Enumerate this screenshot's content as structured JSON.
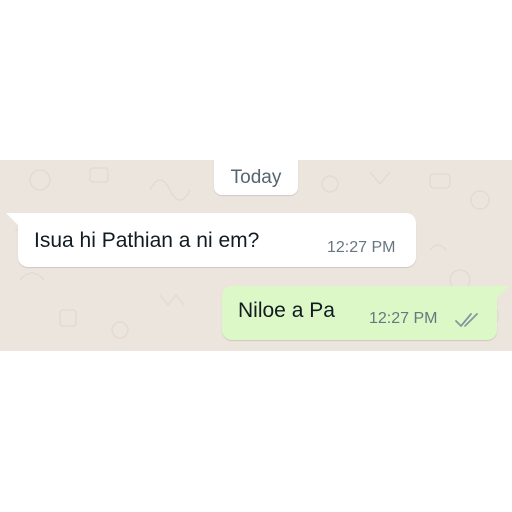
{
  "chat": {
    "date_separator": "Today",
    "messages": [
      {
        "direction": "incoming",
        "text": "Isua hi Pathian a ni em?",
        "time": "12:27 PM"
      },
      {
        "direction": "outgoing",
        "text": "Niloe a Pa",
        "time": "12:27 PM",
        "status_icon": "double-check-icon"
      }
    ]
  },
  "colors": {
    "chat_background": "#ece5dd",
    "incoming_bubble": "#ffffff",
    "outgoing_bubble": "#dcf8c6",
    "timestamp": "#667781",
    "ticks": "#8696a0"
  }
}
